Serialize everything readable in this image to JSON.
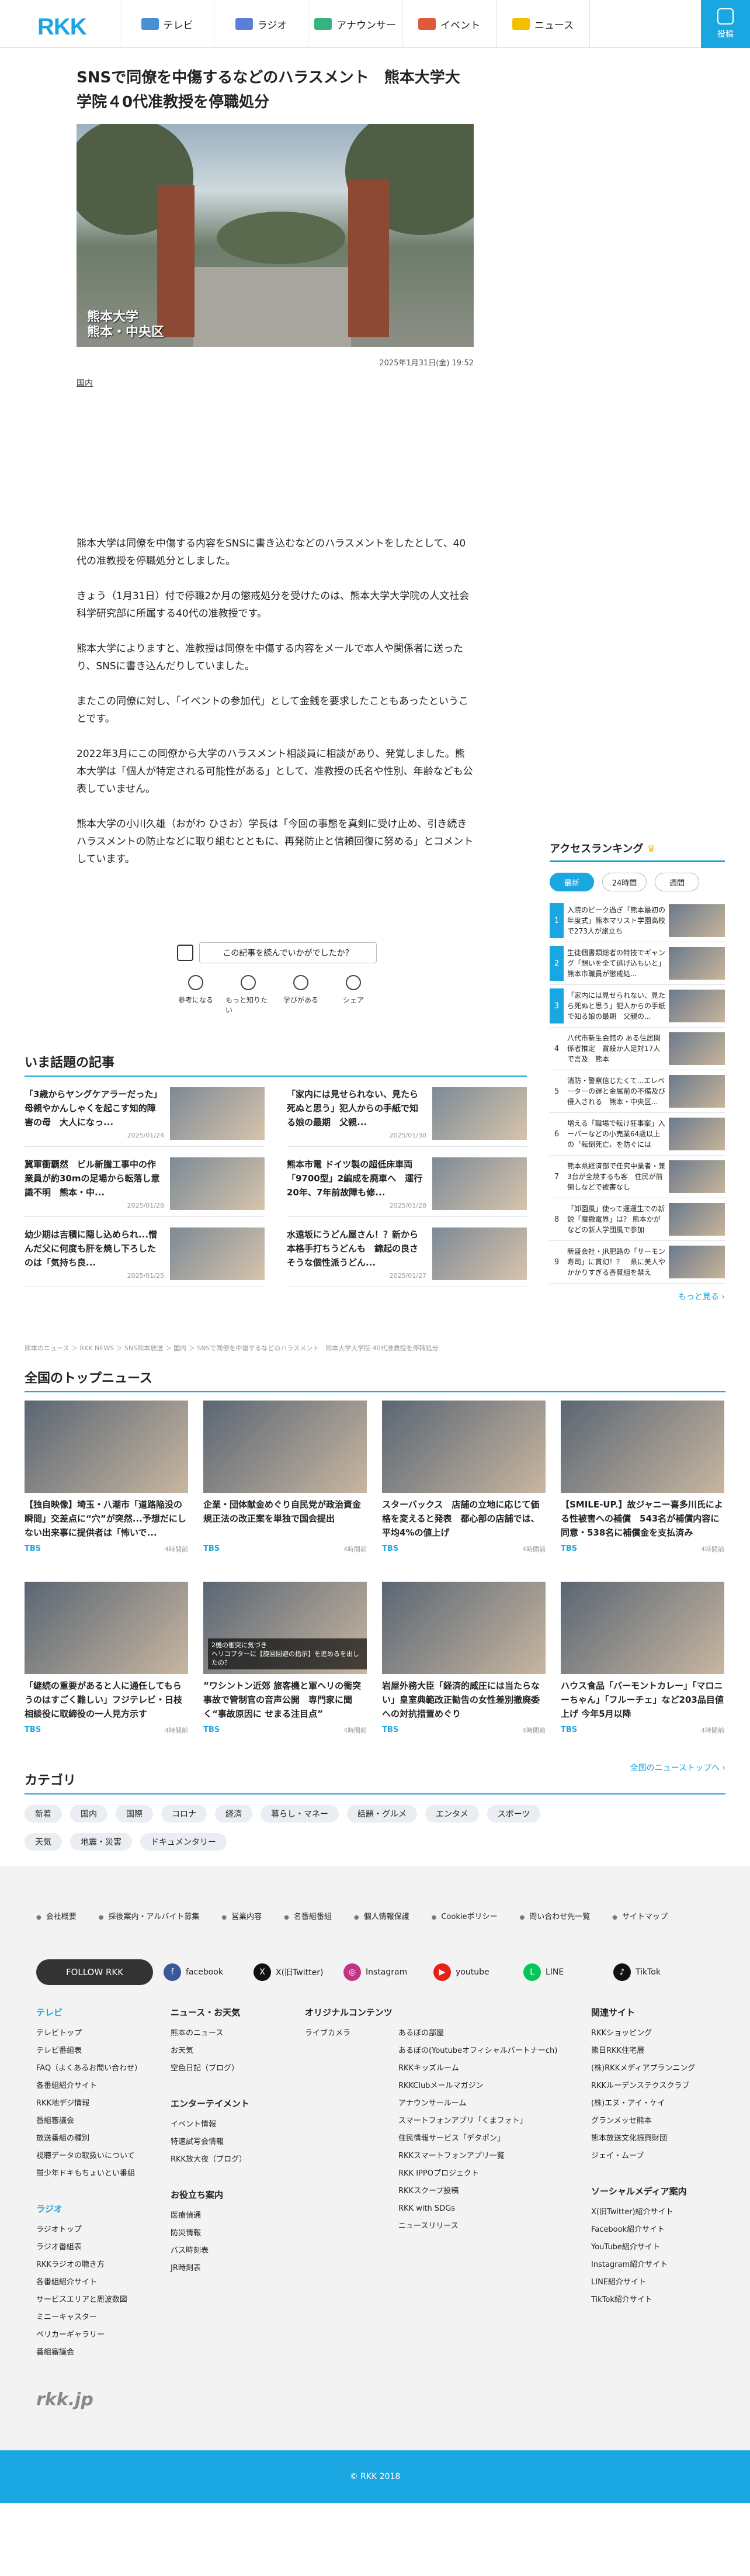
{
  "header": {
    "logo": "RKK",
    "nav": [
      {
        "label": "テレビ",
        "icon": "tv-icon",
        "color": "#4a8fd4"
      },
      {
        "label": "ラジオ",
        "icon": "radio-icon",
        "color": "#5b7fd9"
      },
      {
        "label": "アナウンサー",
        "icon": "mic-icon",
        "color": "#36b37e"
      },
      {
        "label": "イベント",
        "icon": "event-icon",
        "color": "#e05a3a"
      },
      {
        "label": "ニュース",
        "icon": "news-icon",
        "color": "#f5c000"
      }
    ],
    "post_label": "投稿"
  },
  "article": {
    "title": "SNSで同僚を中傷するなどのハラスメント　熊本大学大学院４0代准教授を停職処分",
    "image_caption": "熊本大学\n熊本・中央区",
    "date": "2025年1月31日(金) 19:52",
    "category": "国内",
    "paragraphs": [
      "熊本大学は同僚を中傷する内容をSNSに書き込むなどのハラスメントをしたとして、40代の准教授を停職処分としました。",
      "きょう（1月31日）付で停職2か月の懲戒処分を受けたのは、熊本大学大学院の人文社会科学研究部に所属する40代の准教授です。",
      "熊本大学によりますと、准教授は同僚を中傷する内容をメールで本人や関係者に送ったり、SNSに書き込んだりしていました。",
      "またこの同僚に対し、「イベントの参加代」として金銭を要求したこともあったということです。",
      "2022年3月にこの同僚から大学のハラスメント相談員に相談があり、発覚しました。熊本大学は「個人が特定される可能性がある」として、准教授の氏名や性別、年齢なども公表していません。",
      "熊本大学の小川久雄（おがわ ひさお）学長は「今回の事態を真剣に受け止め、引き続きハラスメントの防止などに取り組むとともに、再発防止と信頼回復に努める」とコメントしています。"
    ],
    "ask": "この記事を読んでいかがでしたか？",
    "reactions": [
      {
        "label": "参考になる",
        "icon": "lightbulb-icon"
      },
      {
        "label": "もっと知りたい",
        "icon": "search-icon"
      },
      {
        "label": "学びがある",
        "icon": "book-icon"
      },
      {
        "label": "シェア",
        "icon": "share-icon"
      }
    ]
  },
  "ranking": {
    "title": "アクセスランキング",
    "tabs": [
      "最新",
      "24時間",
      "週間"
    ],
    "items": [
      {
        "rank": "1",
        "text": "入院のピーク過ぎ「熊本最初の年度式」熊本マリスト学園高校で273人が旅立ち"
      },
      {
        "rank": "2",
        "text": "生徒個書類総者の特技でギャング「想いを全て逃げ込もいと」熊本市職員が懲戒処..."
      },
      {
        "rank": "3",
        "text": "「家内には見せられない、見たら死ぬと思う」犯人からの手紙で知る娘の最期　父親の..."
      },
      {
        "rank": "4",
        "text": "八代市新生会館の ある住居関係者推定　賞殺か人足対17人で言及　熊本"
      },
      {
        "rank": "5",
        "text": "消防・警察信じたくて...エレベーターの遅と金属前の不備及び侵入される　熊本・中央区..."
      },
      {
        "rank": "6",
        "text": "増える「職場で転け狂事案」入ーパーなどの小売業64歳以上の〝転倒死亡〟を防ぐには"
      },
      {
        "rank": "7",
        "text": "熊本県経済部で任究中業者・兼3台が全焼するも客　住民が前倒しなどで被害なし"
      },
      {
        "rank": "8",
        "text": "「卸園風」使って運運生での新鋭「魔撤電界」は？ 熊本かがなどの新人学団風で参加"
      },
      {
        "rank": "9",
        "text": "新盛会社・JR肥路の「サーモン寿司」に貫幻！？　県に美人やかかりすぎる香質組を禁え"
      }
    ],
    "more": "もっと見る ›"
  },
  "trending": {
    "title": "いま話題の記事",
    "items": [
      {
        "title": "「3歳からヤングケアラーだった」母親やかんしゃくを起こす知的障害の母　大人になっ...",
        "date": "2025/01/24"
      },
      {
        "title": "「家内には見せられない、見たら死ぬと思う」犯人からの手紙で知る娘の最期　父親...",
        "date": "2025/01/30"
      },
      {
        "title": "冀軍衝覇然　ビル新騰工事中の作業員が約30mの足場から転落し意識不明　熊本・中...",
        "date": "2025/01/28"
      },
      {
        "title": "熊本市電 ドイツ製の超低床車両「9700型」2編成を廃車へ　運行20年、7年前故障も修...",
        "date": "2025/01/28"
      },
      {
        "title": "幼少期は吉積に隠し込められ...憎んだ父に何度も肝を焼し下ろしたのは「気持ち良...",
        "date": "2025/01/25"
      },
      {
        "title": "水遠坂にうどん屋さん！？新から本格手打ちうどんも　錦起の良さそうな個性派うどん...",
        "date": "2025/01/27"
      }
    ]
  },
  "breadcrumb": "熊本のニュース ＞ RKK NEWS ＞ SNS熊本放送 ＞ 国内 ＞ SNSで同僚を中傷するなどのハラスメント　熊本大学大学院 40代准教授を停職処分",
  "top_news": {
    "title": "全国のトップニュース",
    "items": [
      {
        "title": "【独自映像】埼玉・八潮市「道路陥没の瞬間」交差点に“穴”が突然...予想だにしない出来事に提供者は「怖いで...",
        "source": "TBS",
        "time": "4時間前"
      },
      {
        "title": "企業・団体献金めぐり自民党が政治資金規正法の改正案を単独で国会提出",
        "source": "TBS",
        "time": "4時間前"
      },
      {
        "title": "スターバックス　店舗の立地に応じて価格を変えると発表　都心部の店舗では、平均4%の値上げ",
        "source": "TBS",
        "time": "4時間前"
      },
      {
        "title": "【SMILE-UP.】故ジャニー喜多川氏による性被害への補償　543名が補償内容に同意・538名に補償金を支払済み",
        "source": "TBS",
        "time": "4時間前"
      },
      {
        "title": "「継続の重要があると人に通任してもらうのはすごく難しい」フジテレビ・日枝相談役に取締役の一人見方示す",
        "source": "TBS",
        "time": "4時間前"
      },
      {
        "title": "”ワシントン近郊 旅客機と軍ヘリの衝突事故で管制官の音声公開　専門家に聞く“事故原因に せまる注目点”",
        "source": "TBS",
        "time": "4時間前"
      },
      {
        "title": "岩屋外務大臣「経済的威圧には当たらない」皇室典範改正勧告の女性差別撤廃委への対抗措置めぐり",
        "source": "TBS",
        "time": "4時間前"
      },
      {
        "title": "ハウス食品「バーモントカレー」「マロニーちゃん」「フルーチェ」など203品目値上げ 今年5月以降",
        "source": "TBS",
        "time": "4時間前"
      }
    ],
    "news_overlay": "2機の衝突に気づき\nヘリコプターに【旋回回避の指示】を進めるを出したの？",
    "more": "全国のニューストップへ ›"
  },
  "categories": {
    "title": "カテゴリ",
    "row1": [
      "新着",
      "国内",
      "国際",
      "コロナ",
      "経済",
      "暮らし・マネー",
      "話題・グルメ",
      "エンタメ",
      "スポーツ"
    ],
    "row2": [
      "天気",
      "地震・災害",
      "ドキュメンタリー"
    ]
  },
  "footer": {
    "links": [
      "会社概要",
      "採後案内・アルバイト募集",
      "営業内容",
      "名番組番組",
      "個人情報保護",
      "Cookieポリシー",
      "問い合わせ先一覧",
      "サイトマップ"
    ],
    "follow": "FOLLOW RKK",
    "sns": [
      {
        "label": "facebook",
        "icon": "facebook-icon",
        "color": "#3b5998",
        "glyph": "f"
      },
      {
        "label": "X(旧Twitter)",
        "icon": "x-icon",
        "color": "#111",
        "glyph": "X"
      },
      {
        "label": "Instagram",
        "icon": "instagram-icon",
        "color": "#c13584",
        "glyph": "◎"
      },
      {
        "label": "youtube",
        "icon": "youtube-icon",
        "color": "#e62117",
        "glyph": "▶"
      },
      {
        "label": "LINE",
        "icon": "line-icon",
        "color": "#06c755",
        "glyph": "L"
      },
      {
        "label": "TikTok",
        "icon": "tiktok-icon",
        "color": "#111",
        "glyph": "♪"
      }
    ],
    "col1": {
      "title": "テレビ",
      "items": [
        "テレビトップ",
        "テレビ番組表",
        "FAQ（よくあるお問い合わせ）",
        "各番組紹介サイト",
        "RKK地デジ情報",
        "番組審議会",
        "放送番組の種別",
        "視聴データの取扱いについて",
        "蛍少年ドキもちょいとい番組"
      ],
      "title2": "ラジオ",
      "items2": [
        "ラジオトップ",
        "ラジオ番組表",
        "RKKラジオの聴き方",
        "各番組紹介サイト",
        "サービスエリアと周波数図",
        "ミニーキャスター",
        "ペリカーギャラリー",
        "番組審議会"
      ]
    },
    "col2": {
      "title": "ニュース・お天気",
      "items": [
        "熊本のニュース",
        "お天気",
        "空色日記（ブログ）"
      ],
      "title2": "エンターテイメント",
      "items2": [
        "イベント情報",
        "特速試写会情報",
        "RKK放大夜（ブログ）"
      ],
      "title3": "お役立ち案内",
      "items3": [
        "医療偵通",
        "防災情報",
        "バス時刻表",
        "JR時刻表"
      ]
    },
    "col3": {
      "title": "オリジナルコンテンツ",
      "items": [
        "ライブカメラ"
      ]
    },
    "col4": {
      "items": [
        "あるぼの部屋",
        "あるぼの(Youtubeオフィシャルパートナーch)",
        "RKKキッズルーム",
        "RKKClubメールマガジン",
        "アナウンサールーム",
        "スマートフォンアプリ「くまフォト」",
        "住民情報サービス「デタポン」",
        "RKKスマートフォンアプリ一覧",
        "RKK IPPOプロジェクト",
        "RKKスクープ投稿",
        "RKK with SDGs",
        "ニュースリリース"
      ]
    },
    "col5": {
      "title": "関連サイト",
      "items": [
        "RKKショッピング",
        "熊日RKK住宅展",
        "(株)RKKメディアプランニング",
        "RKKルーデンステクスクラブ",
        "(株)エヌ・アイ・ケイ",
        "グランメッセ熊本",
        "熊本放送文化振興財団",
        "ジェイ・ムーブ"
      ],
      "title2": "ソーシャルメディア案内",
      "items2": [
        "X(旧Twitter)紹介サイト",
        "Facebook紹介サイト",
        "YouTube紹介サイト",
        "Instagram紹介サイト",
        "LINE紹介サイト",
        "TikTok紹介サイト"
      ]
    },
    "small_logo": "rkk.jp",
    "copyright": "© RKK 2018"
  }
}
